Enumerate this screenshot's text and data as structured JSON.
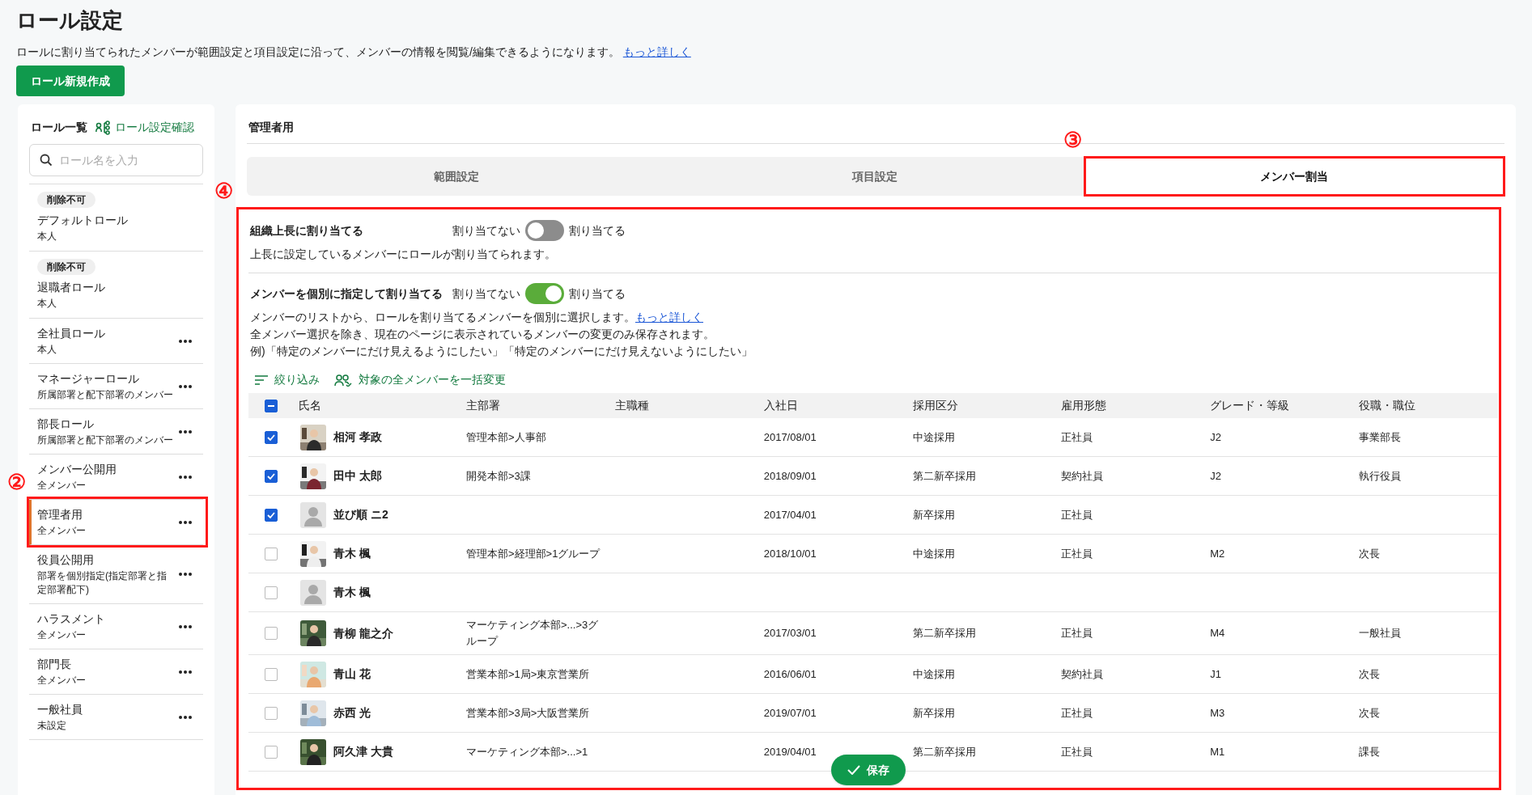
{
  "page": {
    "title": "ロール設定",
    "description": "ロールに割り当てられたメンバーが範囲設定と項目設定に沿って、メンバーの情報を閲覧/編集できるようになります。",
    "description_link": "もっと詳しく",
    "create_button": "ロール新規作成"
  },
  "sidebar": {
    "title": "ロール一覧",
    "check_link": "ロール設定確認",
    "search": {
      "placeholder": "ロール名を入力"
    },
    "items": [
      {
        "badge": "削除不可",
        "name": "デフォルトロール",
        "scope": "本人",
        "has_menu": false,
        "selected": false
      },
      {
        "badge": "削除不可",
        "name": "退職者ロール",
        "scope": "本人",
        "has_menu": false,
        "selected": false
      },
      {
        "name": "全社員ロール",
        "scope": "本人",
        "has_menu": true,
        "selected": false
      },
      {
        "name": "マネージャーロール",
        "scope": "所属部署と配下部署のメンバー",
        "has_menu": true,
        "selected": false
      },
      {
        "name": "部長ロール",
        "scope": "所属部署と配下部署のメンバー",
        "has_menu": true,
        "selected": false
      },
      {
        "name": "メンバー公開用",
        "scope": "全メンバー",
        "has_menu": true,
        "selected": false
      },
      {
        "name": "管理者用",
        "scope": "全メンバー",
        "has_menu": true,
        "selected": true,
        "callout": "②"
      },
      {
        "name": "役員公開用",
        "scope": "部署を個別指定(指定部署と指定部署配下)",
        "has_menu": true,
        "selected": false
      },
      {
        "name": "ハラスメント",
        "scope": "全メンバー",
        "has_menu": true,
        "selected": false
      },
      {
        "name": "部門長",
        "scope": "全メンバー",
        "has_menu": true,
        "selected": false
      },
      {
        "name": "一般社員",
        "scope": "未設定",
        "has_menu": true,
        "selected": false
      }
    ]
  },
  "panel": {
    "title": "管理者用",
    "tabs": [
      {
        "label": "範囲設定",
        "selected": false
      },
      {
        "label": "項目設定",
        "selected": false
      },
      {
        "label": "メンバー割当",
        "selected": true,
        "callout": "③"
      }
    ],
    "content_callout": "④",
    "sections": [
      {
        "title": "組織上長に割り当てる",
        "off_label": "割り当てない",
        "on_label": "割り当てる",
        "on": false,
        "lines": [
          {
            "text": "上長に設定しているメンバーにロールが割り当てられます。"
          }
        ]
      },
      {
        "title": "メンバーを個別に指定して割り当てる",
        "off_label": "割り当てない",
        "on_label": "割り当てる",
        "on": true,
        "lines": [
          {
            "text": "メンバーのリストから、ロールを割り当てるメンバーを個別に選択します。",
            "link": "もっと詳しく"
          },
          {
            "text": "全メンバー選択を除き、現在のページに表示されているメンバーの変更のみ保存されます。"
          },
          {
            "text": "例)「特定のメンバーにだけ見えるようにしたい」「特定のメンバーにだけ見えないようにしたい」"
          }
        ]
      }
    ],
    "toolbar": [
      {
        "kind": "filter",
        "label": "絞り込み"
      },
      {
        "kind": "bulk",
        "label": "対象の全メンバーを一括変更"
      }
    ],
    "table": {
      "select_all": {
        "indeterminate": true
      },
      "columns": [
        "氏名",
        "主部署",
        "主職種",
        "入社日",
        "採用区分",
        "雇用形態",
        "グレード・等級",
        "役職・職位"
      ],
      "rows": [
        {
          "checked": true,
          "name": "相河 孝政",
          "department": "管理本部>人事部",
          "joined": "2017/08/01",
          "hiring": "中途採用",
          "employment": "正社員",
          "grade": "J2",
          "position": "事業部長"
        },
        {
          "checked": true,
          "name": "田中 太郎",
          "department": "開発本部>3課",
          "joined": "2018/09/01",
          "hiring": "第二新卒採用",
          "employment": "契約社員",
          "grade": "J2",
          "position": "執行役員"
        },
        {
          "checked": true,
          "kind": "placeholder",
          "name": "並び順 ニ2",
          "joined": "2017/04/01",
          "hiring": "新卒採用",
          "employment": "正社員"
        },
        {
          "checked": false,
          "name": "青木 楓",
          "department": "管理本部>経理部>1グループ",
          "joined": "2018/10/01",
          "hiring": "中途採用",
          "employment": "正社員",
          "grade": "M2",
          "position": "次長"
        },
        {
          "checked": false,
          "kind": "placeholder",
          "name": "青木 楓"
        },
        {
          "checked": false,
          "name": "青柳 龍之介",
          "department": "マーケティング本部>...>3グループ",
          "joined": "2017/03/01",
          "hiring": "第二新卒採用",
          "employment": "正社員",
          "grade": "M4",
          "position": "一般社員"
        },
        {
          "checked": false,
          "name": "青山 花",
          "department": "営業本部>1局>東京営業所",
          "joined": "2016/06/01",
          "hiring": "中途採用",
          "employment": "契約社員",
          "grade": "J1",
          "position": "次長"
        },
        {
          "checked": false,
          "name": "赤西 光",
          "department": "営業本部>3局>大阪営業所",
          "joined": "2019/07/01",
          "hiring": "新卒採用",
          "employment": "正社員",
          "grade": "M3",
          "position": "次長"
        },
        {
          "checked": false,
          "name": "阿久津 大貴",
          "department": "マーケティング本部>...>1",
          "joined": "2019/04/01",
          "hiring": "第二新卒採用",
          "employment": "正社員",
          "grade": "M1",
          "position": "課長"
        }
      ]
    },
    "save_button": "保存"
  }
}
